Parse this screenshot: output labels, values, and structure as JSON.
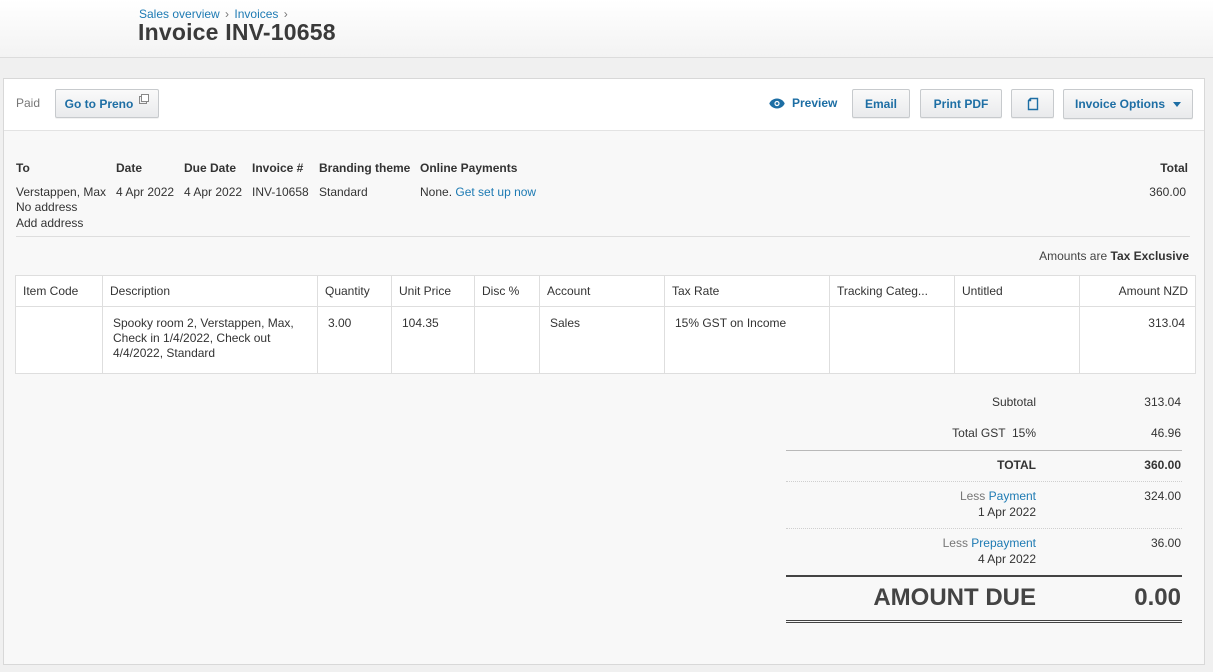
{
  "breadcrumb": {
    "items": [
      "Sales overview",
      "Invoices"
    ],
    "separator": "›"
  },
  "title": "Invoice INV-10658",
  "toolbar": {
    "status": "Paid",
    "go_to": "Go to Preno",
    "preview": "Preview",
    "email": "Email",
    "print_pdf": "Print PDF",
    "invoice_options": "Invoice Options"
  },
  "info": {
    "labels": {
      "to": "To",
      "date": "Date",
      "due_date": "Due Date",
      "invoice_no": "Invoice #",
      "branding": "Branding theme",
      "online_payments": "Online Payments",
      "total": "Total"
    },
    "to_name": "Verstappen, Max",
    "no_address": "No address",
    "add_address": "Add address",
    "date": "4 Apr 2022",
    "due_date": "4 Apr 2022",
    "invoice_no": "INV-10658",
    "branding": "Standard",
    "online_payments_none": "None.",
    "get_set_up": "Get set up now",
    "total": "360.00"
  },
  "amounts_are": {
    "prefix": "Amounts are",
    "value": "Tax Exclusive"
  },
  "table": {
    "columns": [
      "Item Code",
      "Description",
      "Quantity",
      "Unit Price",
      "Disc %",
      "Account",
      "Tax Rate",
      "Tracking Categ...",
      "Untitled",
      "Amount NZD"
    ],
    "rows": [
      {
        "item_code": "",
        "description": "Spooky room 2, Verstappen, Max, Check in 1/4/2022, Check out 4/4/2022, Standard",
        "quantity": "3.00",
        "unit_price": "104.35",
        "disc": "",
        "account": "Sales",
        "tax_rate": "15% GST on Income",
        "tracking": "",
        "untitled": "",
        "amount": "313.04"
      }
    ]
  },
  "totals": {
    "subtotal_label": "Subtotal",
    "subtotal": "313.04",
    "gst_label": "Total GST  15%",
    "gst": "46.96",
    "total_label": "TOTAL",
    "total": "360.00",
    "less": "Less",
    "payment_label": "Payment",
    "payment_date": "1 Apr 2022",
    "payment": "324.00",
    "prepayment_label": "Prepayment",
    "prepayment_date": "4 Apr 2022",
    "prepayment": "36.00",
    "amount_due_label": "AMOUNT DUE",
    "amount_due": "0.00"
  },
  "colors": {
    "link": "#1d7ab3",
    "button_text": "#1d6ea4"
  },
  "icons": [
    "external-link-icon",
    "eye-icon",
    "copy-icon",
    "caret-down-icon"
  ]
}
